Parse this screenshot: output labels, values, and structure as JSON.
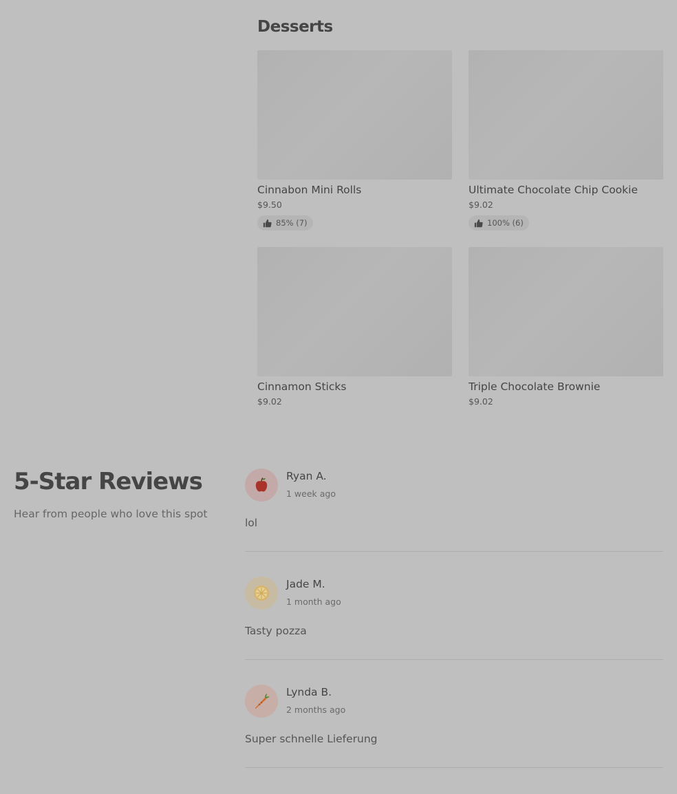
{
  "desserts": {
    "title": "Desserts",
    "items": [
      {
        "name": "Cinnabon Mini Rolls",
        "price": "$9.50",
        "rating": "85% (7)"
      },
      {
        "name": "Ultimate Chocolate Chip Cookie",
        "price": "$9.02",
        "rating": "100% (6)"
      },
      {
        "name": "Cinnamon Sticks",
        "price": "$9.02"
      },
      {
        "name": "Triple Chocolate Brownie",
        "price": "$9.02"
      }
    ]
  },
  "reviews": {
    "title": "5-Star Reviews",
    "subtitle": "Hear from people who love this spot",
    "items": [
      {
        "name": "Ryan A.",
        "time": "1 week ago",
        "text": "lol",
        "avatar_icon": "apple-icon",
        "avatar_bg": "#c4a9a9"
      },
      {
        "name": "Jade M.",
        "time": "1 month ago",
        "text": "Tasty pozza",
        "avatar_icon": "lemon-icon",
        "avatar_bg": "#c7bca3"
      },
      {
        "name": "Lynda B.",
        "time": "2 months ago",
        "text": "Super schnelle Lieferung",
        "avatar_icon": "carrot-icon",
        "avatar_bg": "#c7aea6"
      }
    ]
  }
}
